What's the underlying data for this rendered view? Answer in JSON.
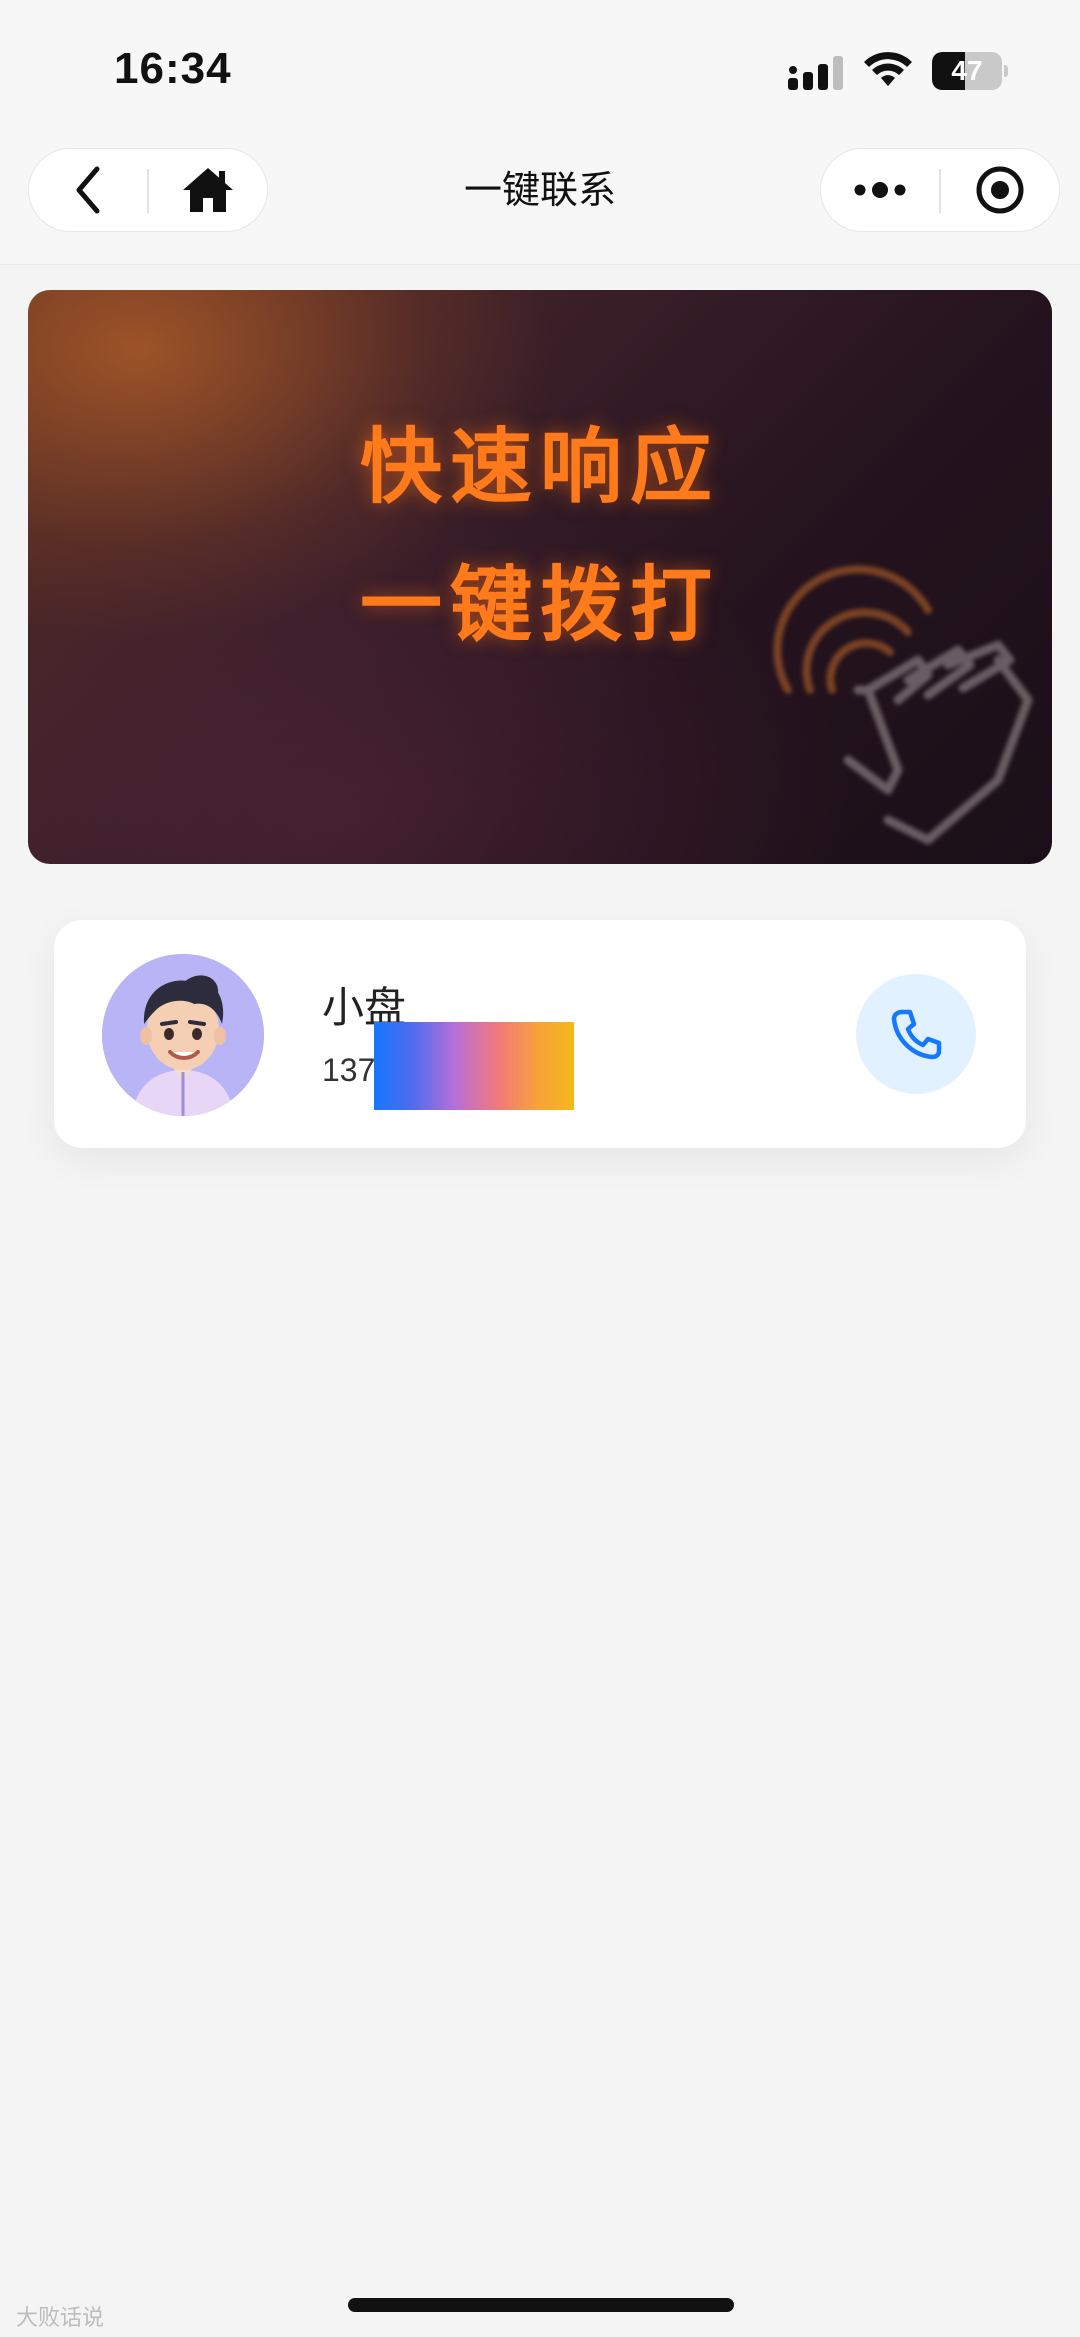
{
  "status_bar": {
    "time": "16:34",
    "battery_level": "47",
    "battery_fraction": 0.47,
    "icons": [
      "signal-icon",
      "wifi-icon",
      "battery-icon"
    ]
  },
  "nav": {
    "title": "一键联系",
    "left_buttons": [
      "back-icon",
      "home-icon"
    ],
    "right_buttons": [
      "more-icon",
      "close-target-icon"
    ]
  },
  "banner": {
    "line1": "快速响应",
    "line2": "一键拨打",
    "accent_color": "#ff7a1a",
    "icon": "tap-hand-icon"
  },
  "contact": {
    "name": "小盘",
    "phone_prefix": "137",
    "phone_masked": true,
    "avatar": "avatar-image",
    "call_icon": "phone-icon",
    "call_color": "#1677ff"
  },
  "footer": {
    "watermark": "大败话说"
  }
}
